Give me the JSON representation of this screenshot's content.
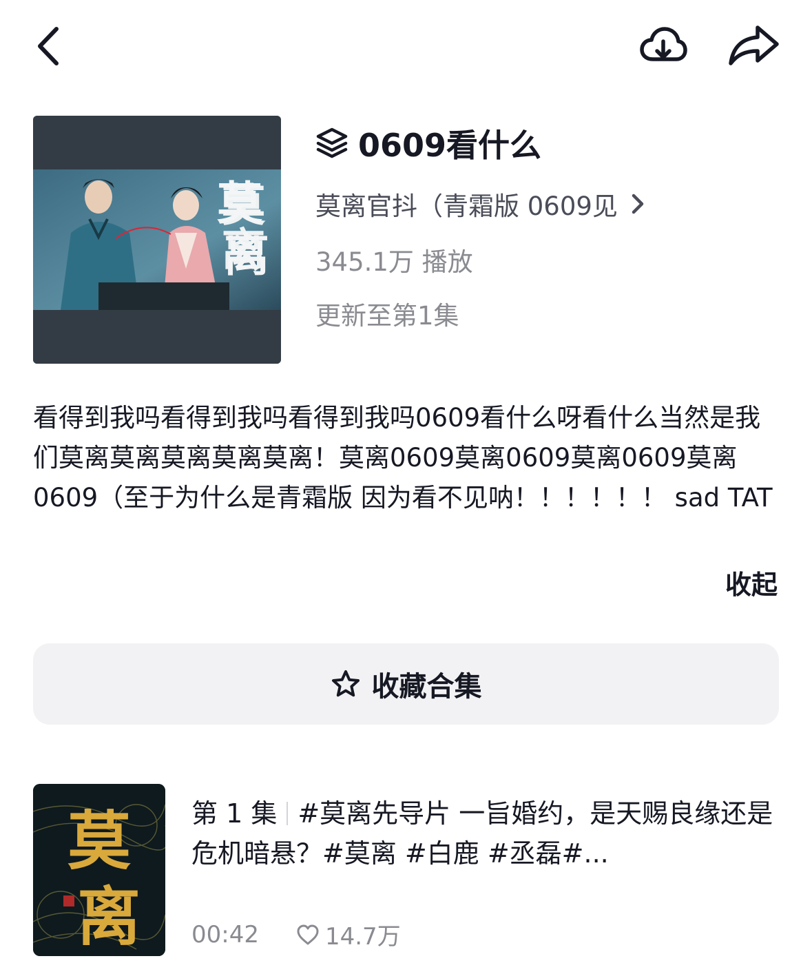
{
  "header": {
    "back_icon": "chevron-left-icon",
    "download_icon": "cloud-download-icon",
    "share_icon": "share-arrow-icon"
  },
  "collection": {
    "title": "0609看什么",
    "title_icon": "layers-icon",
    "author": "莫离官抖（青霜版 0609见",
    "author_chevron_icon": "chevron-right-icon",
    "plays": "345.1万 播放",
    "updated": "更新至第1集",
    "cover_text": "莫离"
  },
  "description": {
    "text": "看得到我吗看得到我吗看得到我吗0609看什么呀看什么当然是我们莫离莫离莫离莫离莫离！莫离0609莫离0609莫离0609莫离0609（至于为什么是青霜版 因为看不见呐！！！！！！ sad TAT",
    "collapse_label": "收起"
  },
  "favorite_button": {
    "label": "收藏合集",
    "icon": "star-outline-icon"
  },
  "episodes": [
    {
      "episode_label": "第 1 集",
      "title": "#莫离先导片 一旨婚约，是天赐良缘还是危机暗悬？#莫离  #白鹿 #丞磊#...",
      "duration": "00:42",
      "likes": "14.7万",
      "like_icon": "heart-outline-icon",
      "thumb_text": "莫离"
    }
  ]
}
